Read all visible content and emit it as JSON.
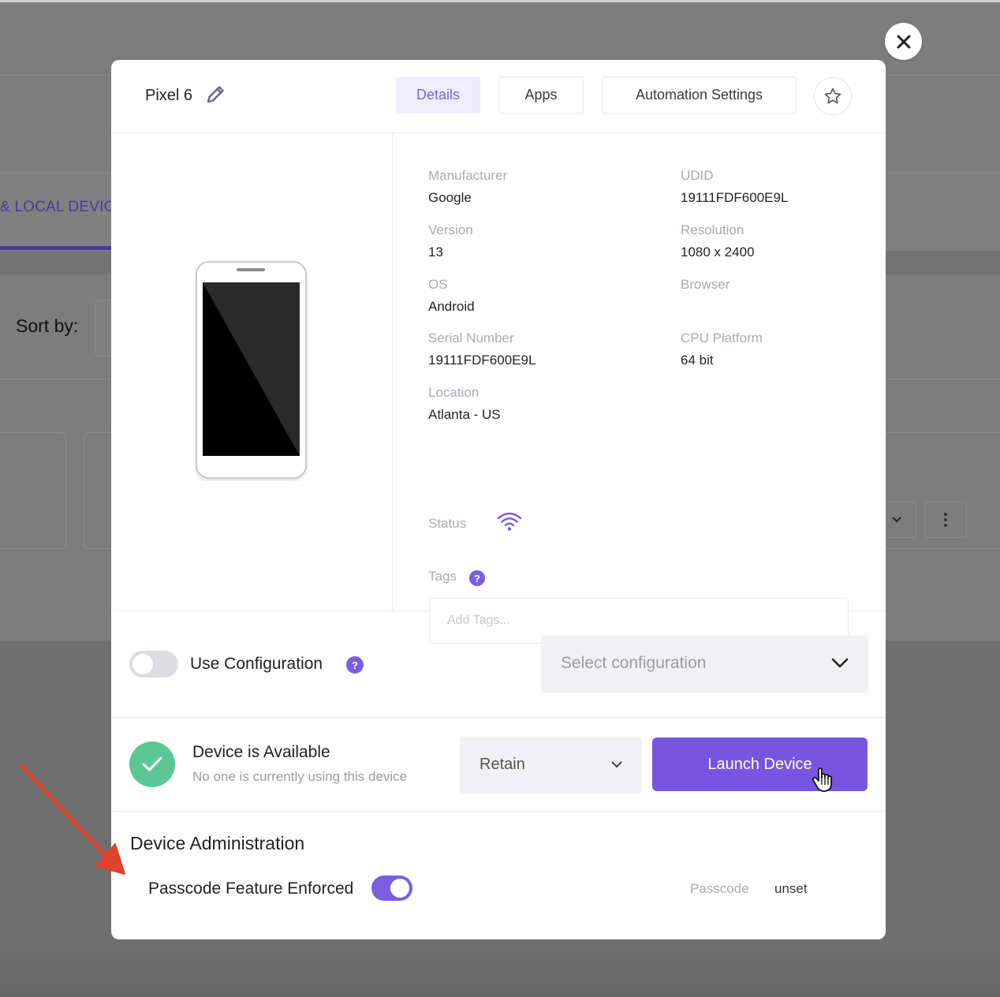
{
  "background": {
    "tab_label": "& LOCAL DEVIC",
    "sort_label": "Sort by:"
  },
  "modal": {
    "device_name": "Pixel 6",
    "tabs": [
      {
        "label": "Details",
        "active": true
      },
      {
        "label": "Apps",
        "active": false
      },
      {
        "label": "Automation Settings",
        "active": false
      }
    ],
    "details": {
      "left_column": [
        {
          "label": "Manufacturer",
          "value": "Google"
        },
        {
          "label": "Version",
          "value": "13"
        },
        {
          "label": "OS",
          "value": "Android"
        },
        {
          "label": "Serial Number",
          "value": "19111FDF600E9L"
        },
        {
          "label": "Location",
          "value": "Atlanta - US"
        }
      ],
      "right_column": [
        {
          "label": "UDID",
          "value": "19111FDF600E9L"
        },
        {
          "label": "Resolution",
          "value": "1080 x 2400"
        },
        {
          "label": "Browser",
          "value": ""
        },
        {
          "label": "CPU Platform",
          "value": "64 bit"
        }
      ],
      "status_label": "Status",
      "tags_label": "Tags",
      "tags_help": "?",
      "tags_placeholder": "Add Tags...",
      "tags_value": ""
    },
    "configuration": {
      "toggle_on": false,
      "label": "Use Configuration",
      "help": "?",
      "select_placeholder": "Select configuration"
    },
    "availability": {
      "title": "Device is Available",
      "subtitle": "No one is currently using this device",
      "retain_value": "Retain",
      "launch_label": "Launch Device"
    },
    "administration": {
      "title": "Device Administration",
      "passcode_feature_label": "Passcode Feature Enforced",
      "passcode_feature_on": true,
      "passcode_key": "Passcode",
      "passcode_value": "unset"
    }
  },
  "colors": {
    "accent": "#7656e0",
    "active_tab_bg": "#efedfb",
    "success": "#5bc794",
    "annotation": "#e0432a"
  },
  "icons": [
    "close-icon",
    "pencil-icon",
    "star-icon",
    "wifi-icon",
    "help-icon",
    "check-icon",
    "chevron-down-icon",
    "hand-cursor-icon"
  ]
}
